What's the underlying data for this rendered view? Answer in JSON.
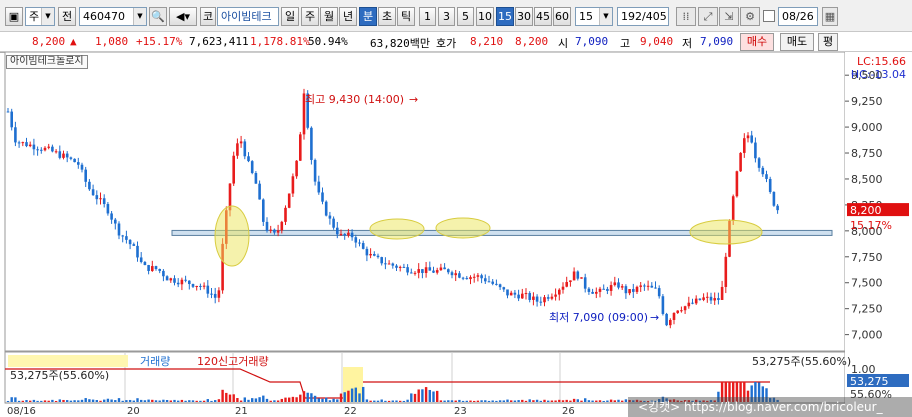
{
  "toolbar": {
    "market": "주",
    "code_label": "전",
    "code": "460470",
    "market_prefix": "코",
    "stock_name": "아이빔테크",
    "periods": [
      "일",
      "주",
      "월",
      "년",
      "분",
      "초",
      "틱"
    ],
    "active_period": "분",
    "intervals": [
      "1",
      "3",
      "5",
      "10",
      "15",
      "30",
      "45",
      "60"
    ],
    "active_interval": "15",
    "interval_value": "15",
    "count": "192",
    "total": "/405",
    "date": "08/26"
  },
  "quote": {
    "price": "8,200",
    "arrow": "▲",
    "change": "1,080",
    "change_pct": "+15.17%",
    "volume": "7,623,411",
    "volume_ratio": "1,178.81%",
    "turnover": "50.94%",
    "amount": "63,820백만",
    "ask_label": "호가",
    "ask": "8,210",
    "bid": "8,200",
    "open_label": "시",
    "open": "7,090",
    "high_label": "고",
    "high": "9,040",
    "low_label": "저",
    "low": "7,090",
    "buy_label": "매수",
    "sell_label": "매도",
    "eval_label": "평"
  },
  "chart": {
    "stock_label": "아이빔테크놀로지",
    "lc": "LC:15.66",
    "hc": "HC:-13.04",
    "high_marker": "최고 9,430 (14:00)",
    "low_marker": "최저 7,090 (09:00)",
    "price_tag": "8,200",
    "pct_tag": "15.17%"
  },
  "volume_panel": {
    "legend_1": "거래량",
    "legend_2": "120신고거래량",
    "left_value": "53,275주(55.60%)",
    "right_value": "53,275주(55.60%)",
    "tag_value": "53,275",
    "tag_pct": "55.60%",
    "scale_top": "1.00"
  },
  "watermark": "<킹캣> https://blog.naver.com/bricoleur_",
  "colors": {
    "up": "#e81c1c",
    "down": "#1e6fd0",
    "accent": "#2e6cc0"
  },
  "chart_data": {
    "type": "candlestick",
    "y_ticks": [
      "9,500",
      "9,250",
      "9,000",
      "8,750",
      "8,500",
      "8,250",
      "8,000",
      "7,750",
      "7,500",
      "7,250",
      "7,000"
    ],
    "ylim": [
      6900,
      9550
    ],
    "x_labels": [
      "08/16",
      "20",
      "21",
      "22",
      "23",
      "26"
    ],
    "support_line": 7980,
    "high": 9430,
    "low": 7090,
    "last": 8200
  }
}
